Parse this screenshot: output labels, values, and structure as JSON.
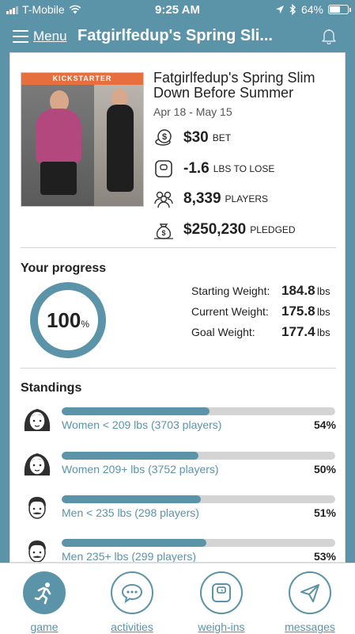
{
  "status_bar": {
    "carrier": "T-Mobile",
    "time": "9:25 AM",
    "battery": "64%",
    "battery_level": 0.64
  },
  "nav": {
    "menu_label": "Menu",
    "title": "Fatgirlfedup's Spring Sli..."
  },
  "challenge": {
    "image_banner": "KICKSTARTER",
    "title": "Fatgirlfedup's Spring Slim Down Before Summer",
    "dates": "Apr 18 - May 15",
    "stats": [
      {
        "icon": "coin-icon",
        "value": "$30",
        "label": "BET"
      },
      {
        "icon": "scale-icon",
        "value": "-1.6",
        "label": "LBS TO LOSE"
      },
      {
        "icon": "players-icon",
        "value": "8,339",
        "label": "PLAYERS"
      },
      {
        "icon": "money-bag-icon",
        "value": "$250,230",
        "label": "PLEDGED"
      }
    ]
  },
  "progress": {
    "heading": "Your progress",
    "percent": "100",
    "percent_sign": "%",
    "starting_label": "Starting Weight:",
    "starting_value": "184.8",
    "current_label": "Current Weight:",
    "current_value": "175.8",
    "goal_label": "Goal Weight:",
    "goal_value": "177.4",
    "unit": "lbs"
  },
  "standings": {
    "heading": "Standings",
    "items": [
      {
        "label": "Women < 209 lbs (3703 players)",
        "percent": "54%",
        "fill": 0.54,
        "avatar": "woman-avatar-icon"
      },
      {
        "label": "Women 209+ lbs (3752 players)",
        "percent": "50%",
        "fill": 0.5,
        "avatar": "woman-avatar-icon"
      },
      {
        "label": "Men < 235 lbs (298 players)",
        "percent": "51%",
        "fill": 0.51,
        "avatar": "man-avatar-icon"
      },
      {
        "label": "Men 235+ lbs (299 players)",
        "percent": "53%",
        "fill": 0.53,
        "avatar": "man-avatar-icon"
      }
    ]
  },
  "tabs": [
    {
      "label": "game",
      "icon": "runner-icon",
      "active": true
    },
    {
      "label": "activities",
      "icon": "chat-bubble-icon",
      "active": false
    },
    {
      "label": "weigh-ins",
      "icon": "scale-icon",
      "active": false
    },
    {
      "label": "messages",
      "icon": "send-icon",
      "active": false
    }
  ],
  "colors": {
    "brand": "#5b93a9",
    "banner": "#e66f3d"
  }
}
